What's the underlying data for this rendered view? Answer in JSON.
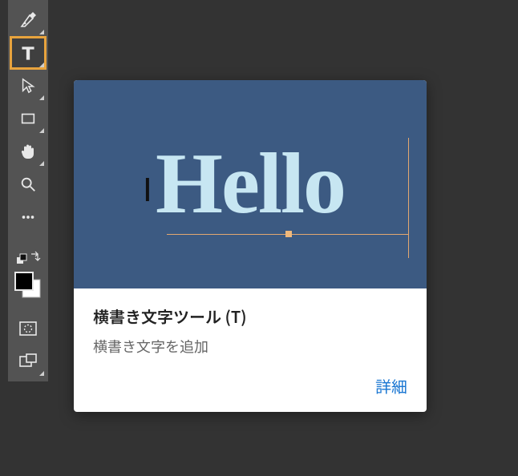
{
  "toolbar": {
    "tools": [
      {
        "name": "pen-tool",
        "glyph": "pen"
      },
      {
        "name": "type-tool",
        "glyph": "type",
        "selected": true
      },
      {
        "name": "path-selection-tool",
        "glyph": "arrow"
      },
      {
        "name": "rectangle-tool",
        "glyph": "rect"
      },
      {
        "name": "hand-tool",
        "glyph": "hand"
      },
      {
        "name": "zoom-tool",
        "glyph": "zoom"
      },
      {
        "name": "more-tools",
        "glyph": "dots"
      },
      {
        "name": "foreground-background",
        "glyph": "fgbg"
      },
      {
        "name": "quick-mask",
        "glyph": "qmask"
      },
      {
        "name": "screen-mode",
        "glyph": "screen"
      }
    ]
  },
  "tooltip": {
    "preview_text": "Hello",
    "title": "横書き文字ツール (T)",
    "description": "横書き文字を追加",
    "learn_more": "詳細"
  }
}
